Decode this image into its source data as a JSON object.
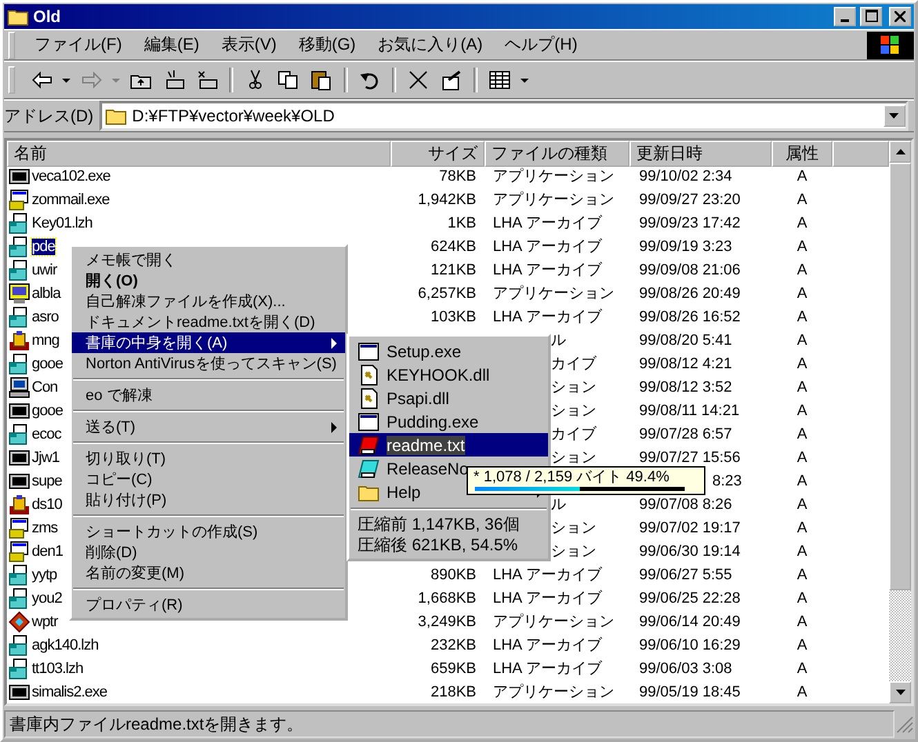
{
  "window": {
    "title": "Old"
  },
  "menu_bar": [
    "ファイル(F)",
    "編集(E)",
    "表示(V)",
    "移動(G)",
    "お気に入り(A)",
    "ヘルプ(H)"
  ],
  "address": {
    "label": "アドレス(D)",
    "value": "D:¥FTP¥vector¥week¥OLD"
  },
  "columns": [
    "名前",
    "サイズ",
    "ファイルの種類",
    "更新日時",
    "属性"
  ],
  "rows": [
    {
      "kind": "console",
      "name": "veca102.exe",
      "size": "78KB",
      "type": "アプリケーション",
      "modified": "99/10/02 2:34",
      "attr": "A",
      "selected": false
    },
    {
      "kind": "installer",
      "name": "zommail.exe",
      "size": "1,942KB",
      "type": "アプリケーション",
      "modified": "99/09/27 23:20",
      "attr": "A",
      "selected": false
    },
    {
      "kind": "lzh",
      "name": "Key01.lzh",
      "size": "1KB",
      "type": "LHA アーカイブ",
      "modified": "99/09/23 17:42",
      "attr": "A",
      "selected": false
    },
    {
      "kind": "lzh",
      "name": "pde",
      "size": "624KB",
      "type": "LHA アーカイブ",
      "modified": "99/09/19 3:23",
      "attr": "A",
      "selected": true
    },
    {
      "kind": "lzh",
      "name": "uwir",
      "size": "121KB",
      "type": "LHA アーカイブ",
      "modified": "99/09/08 21:06",
      "attr": "A",
      "selected": false
    },
    {
      "kind": "zip",
      "name": "albla",
      "size": "6,257KB",
      "type": "アプリケーション",
      "modified": "99/08/26 20:49",
      "attr": "A",
      "selected": false
    },
    {
      "kind": "lzh",
      "name": "asro",
      "size": "103KB",
      "type": "LHA アーカイブ",
      "modified": "99/08/26 16:52",
      "attr": "A",
      "selected": false
    },
    {
      "kind": "box",
      "name": "mng",
      "type": "ル",
      "modified": "99/08/20 5:41",
      "attr": "A",
      "selected": false
    },
    {
      "kind": "lzh",
      "name": "gooe",
      "type": "カイブ",
      "modified": "99/08/12 4:21",
      "attr": "A",
      "selected": false
    },
    {
      "kind": "pc",
      "name": "Con",
      "type": "ション",
      "modified": "99/08/12 3:52",
      "attr": "A",
      "selected": false
    },
    {
      "kind": "console",
      "name": "gooe",
      "type": "ション",
      "modified": "99/08/11 14:21",
      "attr": "A",
      "selected": false
    },
    {
      "kind": "lzh",
      "name": "ecoc",
      "type": "カイブ",
      "modified": "99/07/28 6:57",
      "attr": "A",
      "selected": false
    },
    {
      "kind": "console",
      "name": "Jjw1",
      "type": "ション",
      "modified": "99/07/27 15:56",
      "attr": "A",
      "selected": false
    },
    {
      "kind": "console",
      "name": "supe",
      "modified": "8:23",
      "attr": "A",
      "selected": false
    },
    {
      "kind": "box",
      "name": "ds10",
      "type": "ル",
      "modified": "99/07/08 8:26",
      "attr": "A",
      "selected": false
    },
    {
      "kind": "installer",
      "name": "zms",
      "type": "ション",
      "modified": "99/07/02 19:17",
      "attr": "A",
      "selected": false
    },
    {
      "kind": "installer",
      "name": "den1",
      "type": "ション",
      "modified": "99/06/30 19:14",
      "attr": "A",
      "selected": false
    },
    {
      "kind": "lzh",
      "name": "yytp",
      "size": "890KB",
      "type": "LHA アーカイブ",
      "modified": "99/06/27 5:55",
      "attr": "A",
      "selected": false
    },
    {
      "kind": "lzh",
      "name": "you2",
      "size": "1,668KB",
      "type": "LHA アーカイブ",
      "modified": "99/06/25 22:28",
      "attr": "A",
      "selected": false
    },
    {
      "kind": "gem",
      "name": "wptr",
      "size": "3,249KB",
      "type": "アプリケーション",
      "modified": "99/06/14 20:49",
      "attr": "A",
      "selected": false
    },
    {
      "kind": "lzh",
      "name": "agk140.lzh",
      "size": "232KB",
      "type": "LHA アーカイブ",
      "modified": "99/06/10 16:29",
      "attr": "A",
      "selected": false
    },
    {
      "kind": "lzh",
      "name": "tt103.lzh",
      "size": "659KB",
      "type": "LHA アーカイブ",
      "modified": "99/06/03 3:08",
      "attr": "A",
      "selected": false
    },
    {
      "kind": "console",
      "name": "simalis2.exe",
      "size": "218KB",
      "type": "アプリケーション",
      "modified": "99/05/19 18:45",
      "attr": "A",
      "selected": false
    }
  ],
  "context_menu": [
    {
      "kind": "item",
      "label": "メモ帳で開く",
      "selected": false
    },
    {
      "kind": "item",
      "label": "開く(O)",
      "bold": true,
      "selected": false
    },
    {
      "kind": "item",
      "label": "自己解凍ファイルを作成(X)...",
      "selected": false
    },
    {
      "kind": "item",
      "label": "ドキュメントreadme.txtを開く(D)",
      "selected": false
    },
    {
      "kind": "item",
      "label": "書庫の中身を開く(A)",
      "submenu": true,
      "selected": true
    },
    {
      "kind": "item",
      "label": "Norton AntiVirusを使ってスキャン(S)",
      "selected": false
    },
    {
      "kind": "separator"
    },
    {
      "kind": "item",
      "label": "eo で解凍",
      "selected": false
    },
    {
      "kind": "separator"
    },
    {
      "kind": "item",
      "label": "送る(T)",
      "submenu": true,
      "selected": false
    },
    {
      "kind": "separator"
    },
    {
      "kind": "item",
      "label": "切り取り(T)",
      "selected": false
    },
    {
      "kind": "item",
      "label": "コピー(C)",
      "selected": false
    },
    {
      "kind": "item",
      "label": "貼り付け(P)",
      "selected": false
    },
    {
      "kind": "separator"
    },
    {
      "kind": "item",
      "label": "ショートカットの作成(S)",
      "selected": false
    },
    {
      "kind": "item",
      "label": "削除(D)",
      "selected": false
    },
    {
      "kind": "item",
      "label": "名前の変更(M)",
      "selected": false
    },
    {
      "kind": "separator"
    },
    {
      "kind": "item",
      "label": "プロパティ(R)",
      "selected": false
    }
  ],
  "submenu": [
    {
      "kind": "program",
      "label": "Setup.exe",
      "selected": false
    },
    {
      "kind": "library",
      "label": "KEYHOOK.dll",
      "selected": false
    },
    {
      "kind": "library",
      "label": "Psapi.dll",
      "selected": false
    },
    {
      "kind": "program",
      "label": "Pudding.exe",
      "selected": false
    },
    {
      "kind": "text",
      "label": "readme.txt",
      "selected": true
    },
    {
      "kind": "document",
      "label": "ReleaseNo",
      "selected": false
    },
    {
      "kind": "folder",
      "label": "Help",
      "submenu": true,
      "selected": false
    },
    {
      "kind": "separator"
    },
    {
      "kind": "info",
      "label": "圧縮前 1,147KB, 36個"
    },
    {
      "kind": "info",
      "label": "圧縮後 621KB, 54.5%"
    }
  ],
  "tooltip": {
    "text": "* 1,078 / 2,159 バイト 49.4%",
    "level": 0.5
  },
  "status_bar": "書庫内ファイルreadme.txtを開きます。"
}
